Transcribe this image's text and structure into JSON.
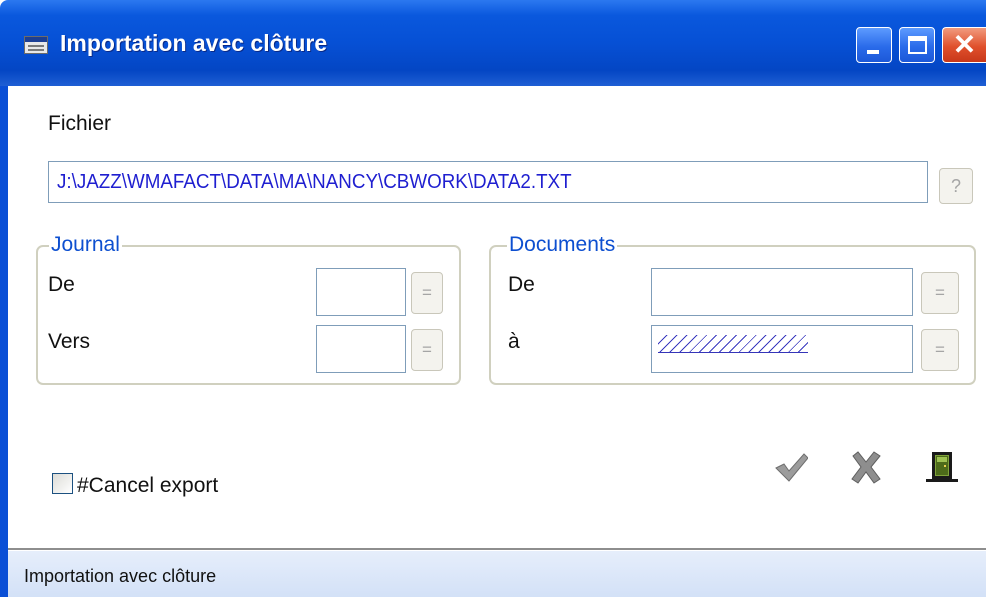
{
  "window": {
    "title": "Importation avec clôture",
    "controls": {
      "minimize": "minimize-icon",
      "maximize": "maximize-icon",
      "close": "close-icon"
    }
  },
  "fichier": {
    "label": "Fichier",
    "value": "J:\\JAZZ\\WMAFACT\\DATA\\MA\\NANCY\\CBWORK\\DATA2.TXT",
    "browse_label": "?"
  },
  "journal": {
    "legend": "Journal",
    "from_label": "De",
    "from_value": "",
    "to_label": "Vers",
    "to_value": "",
    "lookup_label": "="
  },
  "documents": {
    "legend": "Documents",
    "from_label": "De",
    "from_value": "",
    "to_label": "à",
    "to_value": "ZZZZZZZZZZ",
    "lookup_label": "="
  },
  "options": {
    "cancel_export_label": "#Cancel export",
    "cancel_export_checked": false
  },
  "actions": {
    "ok_icon": "checkmark-icon",
    "cancel_icon": "x-icon",
    "exit_icon": "door-icon"
  },
  "statusbar": {
    "text": "Importation avec clôture"
  },
  "colors": {
    "titlebar": "#0650d5",
    "legend_text": "#0d4fd0",
    "path_text": "#1f1fd0",
    "close_button": "#e0502c",
    "statusbar": "#dbe6f8"
  }
}
